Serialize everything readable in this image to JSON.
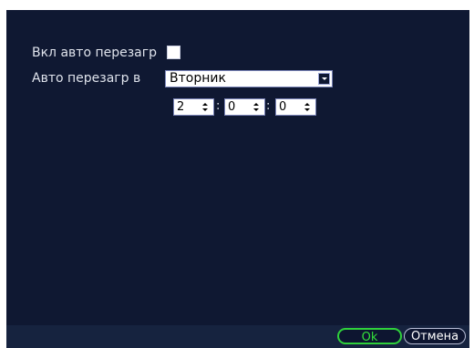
{
  "settings": {
    "auto_reboot_label": "Вкл авто перезагр",
    "auto_reboot_checked": true,
    "reboot_at_label": "Авто перезагр в",
    "day_value": "Вторник",
    "time": {
      "hour": "2",
      "minute": "0",
      "second": "0",
      "separator": ":"
    }
  },
  "footer": {
    "ok_label": "Ok",
    "cancel_label": "Отмена"
  },
  "colors": {
    "panel": "#0f1832",
    "ok_accent": "#33e03b",
    "text": "#dfe3ec"
  }
}
